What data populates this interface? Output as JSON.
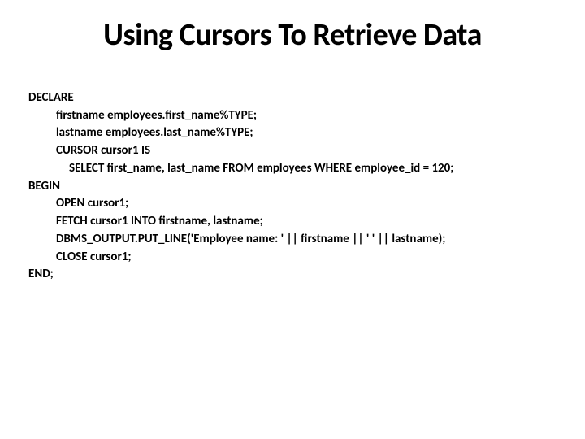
{
  "title": "Using Cursors To Retrieve Data",
  "code": {
    "l1": "DECLARE",
    "l2": "firstname employees.first_name%TYPE;",
    "l3": "lastname employees.last_name%TYPE;",
    "l4": "CURSOR cursor1 IS",
    "l5": "SELECT first_name, last_name FROM employees WHERE employee_id = 120;",
    "l6": "BEGIN",
    "l7": "OPEN cursor1;",
    "l8": "FETCH cursor1 INTO firstname, lastname;",
    "l9": "DBMS_OUTPUT.PUT_LINE('Employee name: ' || firstname || ' ' || lastname);",
    "l10": "CLOSE cursor1;",
    "l11": "END;"
  }
}
